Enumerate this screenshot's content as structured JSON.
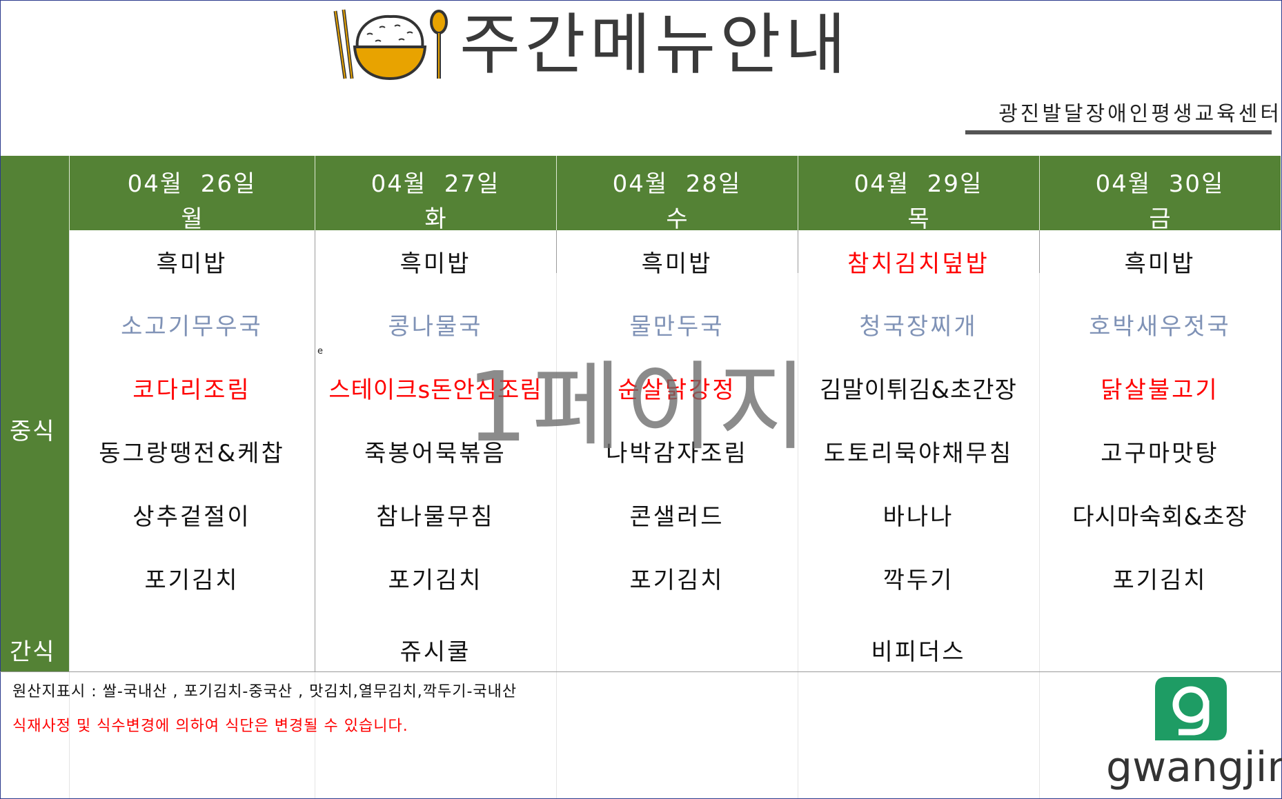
{
  "header": {
    "title": "주간메뉴안내",
    "center_name": "광진발달장애인평생교육센터"
  },
  "days": [
    {
      "date": "04월  26일",
      "weekday": "월"
    },
    {
      "date": "04월  27일",
      "weekday": "화"
    },
    {
      "date": "04월  28일",
      "weekday": "수"
    },
    {
      "date": "04월  29일",
      "weekday": "목"
    },
    {
      "date": "04월  30일",
      "weekday": "금"
    }
  ],
  "row_labels": {
    "lunch": "중식",
    "snack": "간식"
  },
  "menu": [
    [
      "흑미밥",
      "흑미밥",
      "흑미밥",
      "참치김치덮밥",
      "흑미밥"
    ],
    [
      "소고기무우국",
      "콩나물국",
      "물만두국",
      "청국장찌개",
      "호박새우젓국"
    ],
    [
      "코다리조림",
      "스테이크s돈안심조림",
      "순살닭강정",
      "김말이튀김&초간장",
      "닭살불고기"
    ],
    [
      "동그랑땡전&케찹",
      "죽봉어묵볶음",
      "나박감자조림",
      "도토리묵야채무침",
      "고구마맛탕"
    ],
    [
      "상추겉절이",
      "참나물무침",
      "콘샐러드",
      "바나나",
      "다시마숙회&초장"
    ],
    [
      "포기김치",
      "포기김치",
      "포기김치",
      "깍두기",
      "포기김치"
    ]
  ],
  "snacks": [
    "",
    "쥬시쿨",
    "",
    "비피더스",
    ""
  ],
  "watermark": "1페이지",
  "stray_mark": "e",
  "footer": {
    "origin": "원산지표시 : 쌀-국내산 , 포기김치-중국산 , 맛김치,열무김치,깍두기-국내산",
    "notice": "식재사정 및 식수변경에 의하여 식단은 변경될 수 있습니다."
  },
  "logo": {
    "text": "gwangjin"
  },
  "colors": {
    "header_green": "#548235",
    "highlight_red": "#ff0000",
    "soup_blue": "#7f92b6",
    "logo_green": "#1e9c64",
    "bowl_orange": "#e8a300"
  }
}
